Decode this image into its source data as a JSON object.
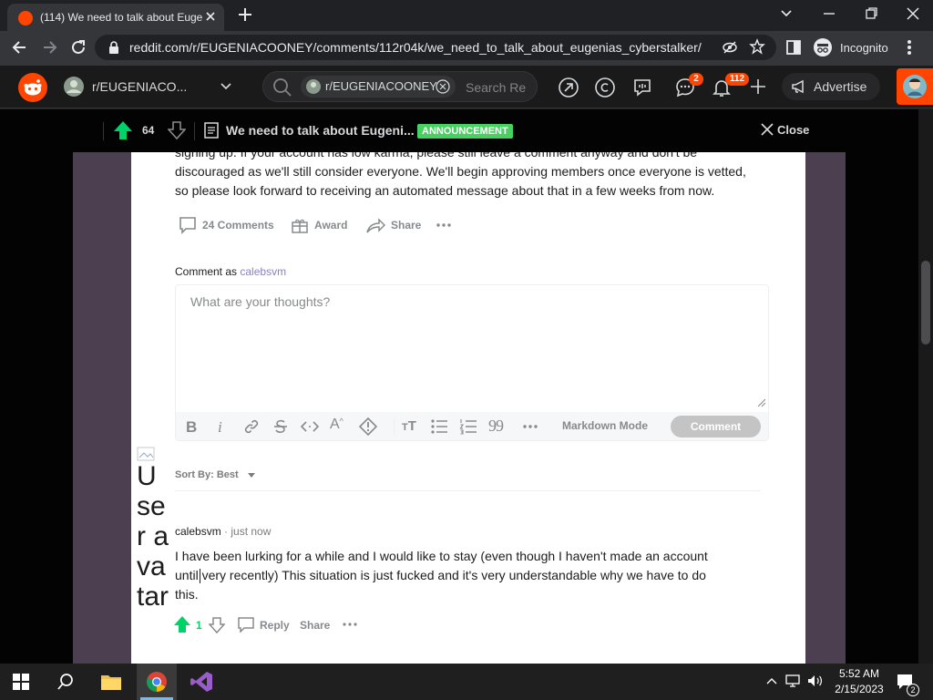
{
  "browser": {
    "tab_title": "(114) We need to talk about Euge",
    "url": "reddit.com/r/EUGENIACOONEY/comments/112r04k/we_need_to_talk_about_eugenias_cyberstalker/",
    "mode_label": "Incognito"
  },
  "reddit_header": {
    "community": "r/EUGENIACO...",
    "search_chip": "r/EUGENIACOONEY",
    "search_placeholder": "Search Re",
    "chat_badge": "2",
    "notif_badge": "112",
    "advertise_label": "Advertise"
  },
  "post_bar": {
    "vote_count": "64",
    "title": "We need to talk about Eugeni...",
    "flair": "ANNOUNCEMENT",
    "close_label": "Close"
  },
  "post": {
    "body_lines": [
      "signing up. If your account has low karma, please still leave a comment anyway and don't be",
      "discouraged as we'll still consider everyone. We'll begin approving members once everyone is vetted,",
      "so please look forward to receiving an automated message about that in a few weeks from now."
    ],
    "comments_label": "24 Comments",
    "award_label": "Award",
    "share_label": "Share"
  },
  "composer": {
    "comment_as_label": "Comment as",
    "username": "calebsvm",
    "placeholder": "What are your thoughts?",
    "markdown_label": "Markdown Mode",
    "submit_label": "Comment"
  },
  "sort": {
    "label": "Sort By: Best"
  },
  "comment": {
    "author": "calebsvm",
    "time": "· just now",
    "body_lines": [
      "I have been lurking for a while and I would like to stay (even though I haven't made an account",
      "until very recently) This situation is just fucked and it's very understandable why we have to do",
      "this."
    ],
    "votes": "1",
    "reply_label": "Reply",
    "share_label": "Share"
  },
  "broken_avatar_alt": "User avatar",
  "taskbar": {
    "time": "5:52 AM",
    "date": "2/15/2023",
    "notif_count": "2"
  },
  "colors": {
    "reddit_orange": "#ff4500",
    "upvote_green": "#00d26a",
    "flair_green": "#46d160"
  }
}
